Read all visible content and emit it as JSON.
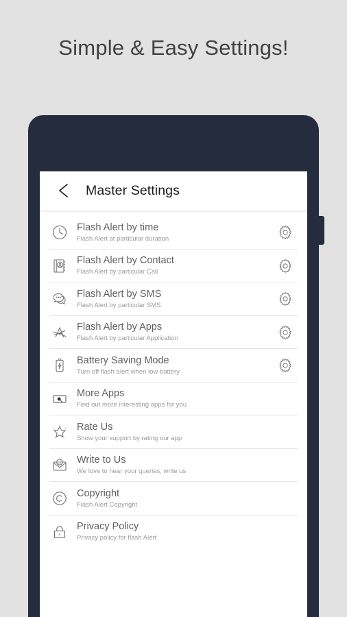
{
  "headline": "Simple & Easy Settings!",
  "colors": {
    "page_background": "#e2e2e2",
    "phone_frame": "#252c3d",
    "screen_background": "#ffffff",
    "title_text": "#5f5f5f",
    "subtitle_text": "#9a9a9a",
    "appbar_title": "#1c1c1c",
    "divider": "#e6e6e6"
  },
  "appbar": {
    "back_icon": "chevron-left-icon",
    "title": "Master Settings"
  },
  "list": {
    "items": [
      {
        "icon": "clock-icon",
        "title": "Flash Alert by time",
        "subtitle": "Flash Alert at particular duration",
        "action_icon": "gear-icon",
        "has_action": true
      },
      {
        "icon": "contact-book-icon",
        "title": "Flash Alert by Contact",
        "subtitle": "Flash Alert by particular Call",
        "action_icon": "gear-icon",
        "has_action": true
      },
      {
        "icon": "chat-bubbles-icon",
        "title": "Flash Alert by SMS",
        "subtitle": "Flash Alert by particular SMS",
        "action_icon": "gear-icon",
        "has_action": true
      },
      {
        "icon": "app-store-icon",
        "title": "Flash Alert by Apps",
        "subtitle": "Flash Alert by particular Application",
        "action_icon": "gear-icon",
        "has_action": true
      },
      {
        "icon": "battery-bolt-icon",
        "title": "Battery Saving Mode",
        "subtitle": "Turn off flash alert when low battery",
        "action_icon": "gear-icon",
        "has_action": true
      },
      {
        "icon": "more-apps-search-icon",
        "title": "More Apps",
        "subtitle": "Find out more interesting apps for you",
        "action_icon": "",
        "has_action": false
      },
      {
        "icon": "star-icon",
        "title": "Rate Us",
        "subtitle": "Show your support by rating our app",
        "action_icon": "",
        "has_action": false
      },
      {
        "icon": "envelope-at-icon",
        "title": "Write to Us",
        "subtitle": "We love to hear your queries, write us",
        "action_icon": "",
        "has_action": false
      },
      {
        "icon": "copyright-icon",
        "title": "Copyright",
        "subtitle": "Flash Alert Copyright",
        "action_icon": "",
        "has_action": false
      },
      {
        "icon": "lock-icon",
        "title": "Privacy Policy",
        "subtitle": "Privacy policy for flash Alert",
        "action_icon": "",
        "has_action": false
      }
    ]
  }
}
